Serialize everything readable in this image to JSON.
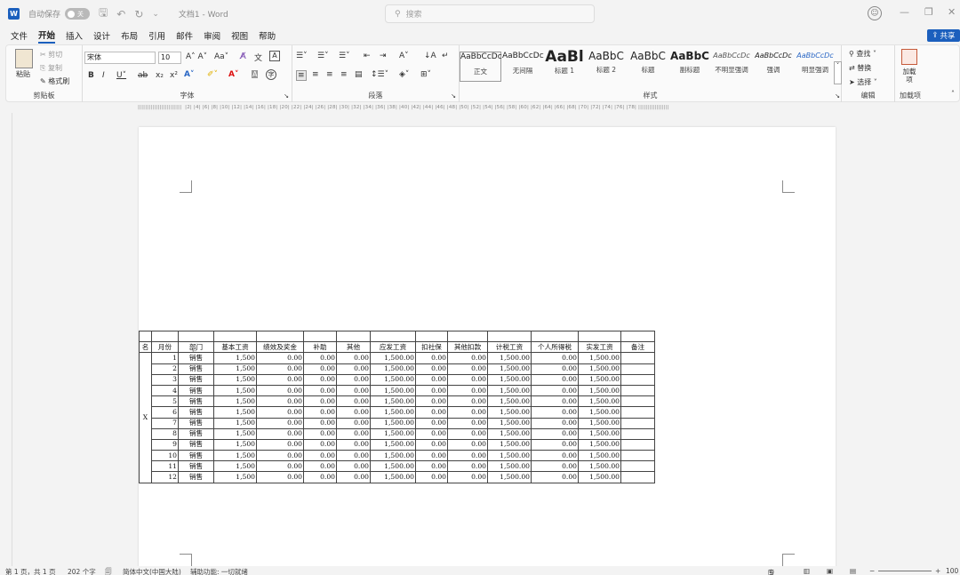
{
  "titlebar": {
    "autosave_label": "自动保存",
    "autosave_state": "关",
    "doc_title": "文档1 - Word",
    "search_placeholder": "搜索"
  },
  "menu": [
    "文件",
    "开始",
    "插入",
    "设计",
    "布局",
    "引用",
    "邮件",
    "审阅",
    "视图",
    "帮助"
  ],
  "share_label": "共享",
  "ribbon": {
    "clipboard": {
      "paste": "粘贴",
      "cut": "剪切",
      "copy": "复制",
      "format_painter": "格式刷",
      "label": "剪贴板"
    },
    "font": {
      "name": "宋体",
      "size": "10",
      "label": "字体"
    },
    "paragraph": {
      "label": "段落"
    },
    "styles": {
      "label": "样式",
      "items": [
        {
          "preview": "AaBbCcDc",
          "name": "正文"
        },
        {
          "preview": "AaBbCcDc",
          "name": "无间隔"
        },
        {
          "preview": "AaBl",
          "name": "标题 1"
        },
        {
          "preview": "AaBbC",
          "name": "标题 2"
        },
        {
          "preview": "AaBbC",
          "name": "标题"
        },
        {
          "preview": "AaBbC",
          "name": "副标题"
        },
        {
          "preview": "AaBbCcDc",
          "name": "不明显强调"
        },
        {
          "preview": "AaBbCcDc",
          "name": "强调"
        },
        {
          "preview": "AaBbCcDc",
          "name": "明显强调"
        }
      ]
    },
    "editing": {
      "find": "查找",
      "replace": "替换",
      "select": "选择",
      "label": "编辑"
    },
    "addins": {
      "item": "加载项",
      "label": "加载项"
    }
  },
  "table": {
    "headers": [
      "名",
      "月份",
      "部门",
      "基本工资",
      "绩效及奖金",
      "补助",
      "其他",
      "应发工资",
      "扣社保",
      "其他扣款",
      "计税工资",
      "个人所得税",
      "实发工资",
      "备注"
    ],
    "side_label": "X",
    "rows": [
      [
        "1",
        "销售",
        "1,500",
        "0.00",
        "0.00",
        "0.00",
        "1,500.00",
        "0.00",
        "0.00",
        "1,500.00",
        "0.00",
        "1,500.00"
      ],
      [
        "2",
        "销售",
        "1,500",
        "0.00",
        "0.00",
        "0.00",
        "1,500.00",
        "0.00",
        "0.00",
        "1,500.00",
        "0.00",
        "1,500.00"
      ],
      [
        "3",
        "销售",
        "1,500",
        "0.00",
        "0.00",
        "0.00",
        "1,500.00",
        "0.00",
        "0.00",
        "1,500.00",
        "0.00",
        "1,500.00"
      ],
      [
        "4",
        "销售",
        "1,500",
        "0.00",
        "0.00",
        "0.00",
        "1,500.00",
        "0.00",
        "0.00",
        "1,500.00",
        "0.00",
        "1,500.00"
      ],
      [
        "5",
        "销售",
        "1,500",
        "0.00",
        "0.00",
        "0.00",
        "1,500.00",
        "0.00",
        "0.00",
        "1,500.00",
        "0.00",
        "1,500.00"
      ],
      [
        "6",
        "销售",
        "1,500",
        "0.00",
        "0.00",
        "0.00",
        "1,500.00",
        "0.00",
        "0.00",
        "1,500.00",
        "0.00",
        "1,500.00"
      ],
      [
        "7",
        "销售",
        "1,500",
        "0.00",
        "0.00",
        "0.00",
        "1,500.00",
        "0.00",
        "0.00",
        "1,500.00",
        "0.00",
        "1,500.00"
      ],
      [
        "8",
        "销售",
        "1,500",
        "0.00",
        "0.00",
        "0.00",
        "1,500.00",
        "0.00",
        "0.00",
        "1,500.00",
        "0.00",
        "1,500.00"
      ],
      [
        "9",
        "销售",
        "1,500",
        "0.00",
        "0.00",
        "0.00",
        "1,500.00",
        "0.00",
        "0.00",
        "1,500.00",
        "0.00",
        "1,500.00"
      ],
      [
        "10",
        "销售",
        "1,500",
        "0.00",
        "0.00",
        "0.00",
        "1,500.00",
        "0.00",
        "0.00",
        "1,500.00",
        "0.00",
        "1,500.00"
      ],
      [
        "11",
        "销售",
        "1,500",
        "0.00",
        "0.00",
        "0.00",
        "1,500.00",
        "0.00",
        "0.00",
        "1,500.00",
        "0.00",
        "1,500.00"
      ],
      [
        "12",
        "销售",
        "1,500",
        "0.00",
        "0.00",
        "0.00",
        "1,500.00",
        "0.00",
        "0.00",
        "1,500.00",
        "0.00",
        "1,500.00"
      ]
    ]
  },
  "status": {
    "page": "第 1 页，共 1 页",
    "words": "202 个字",
    "language": "简体中文(中国大陆)",
    "accessibility": "辅助功能: 一切就绪",
    "focus": "专注",
    "zoom": "100"
  }
}
